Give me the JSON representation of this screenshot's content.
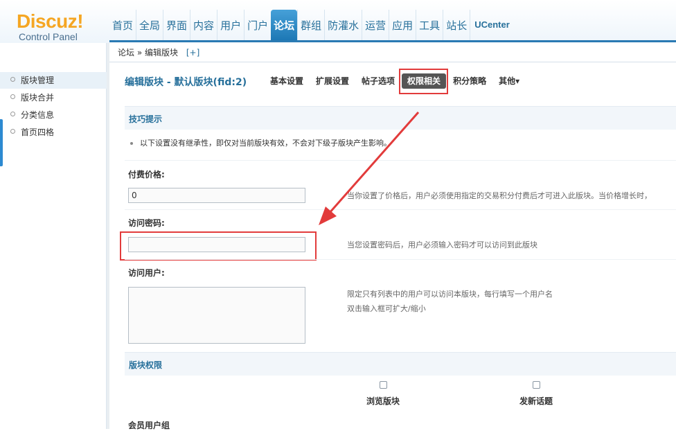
{
  "logo": {
    "main": "Discuz!",
    "sub": "Control Panel"
  },
  "topnav": {
    "items": [
      "首页",
      "全局",
      "界面",
      "内容",
      "用户",
      "门户",
      "论坛",
      "群组",
      "防灌水",
      "运营",
      "应用",
      "工具",
      "站长"
    ],
    "active": "论坛",
    "ucenter": "UCenter"
  },
  "sidebar": {
    "items": [
      "版块管理",
      "版块合并",
      "分类信息",
      "首页四格"
    ],
    "active": "版块管理"
  },
  "breadcrumb": {
    "parts": [
      "论坛",
      "»",
      "编辑版块"
    ],
    "add": "[+]"
  },
  "page": {
    "title": "编辑版块 - 默认版块(fid:2)",
    "tabs": [
      "基本设置",
      "扩展设置",
      "帖子选项",
      "权限相关",
      "积分策略",
      "其他▾"
    ],
    "active_tab": "权限相关"
  },
  "tips": {
    "title": "技巧提示",
    "text": "以下设置没有继承性，即仅对当前版块有效，不会对下级子版块产生影响。"
  },
  "price": {
    "label": "付费价格:",
    "value": "0",
    "note": "当你设置了价格后，用户必须使用指定的交易积分付费后才可进入此版块。当价格增长时，"
  },
  "password": {
    "label": "访问密码:",
    "value": "",
    "note": "当您设置密码后，用户必须输入密码才可以访问到此版块"
  },
  "users": {
    "label": "访问用户:",
    "note1": "限定只有列表中的用户可以访问本版块，每行填写一个用户名",
    "note2": "双击输入框可扩大/缩小"
  },
  "permissions": {
    "title": "版块权限",
    "columns": [
      "浏览版块",
      "发新话题"
    ],
    "group_label": "会员用户组"
  },
  "colors": {
    "accent": "#27709b",
    "highlight": "#e23b3b",
    "logo": "#f5a623"
  }
}
